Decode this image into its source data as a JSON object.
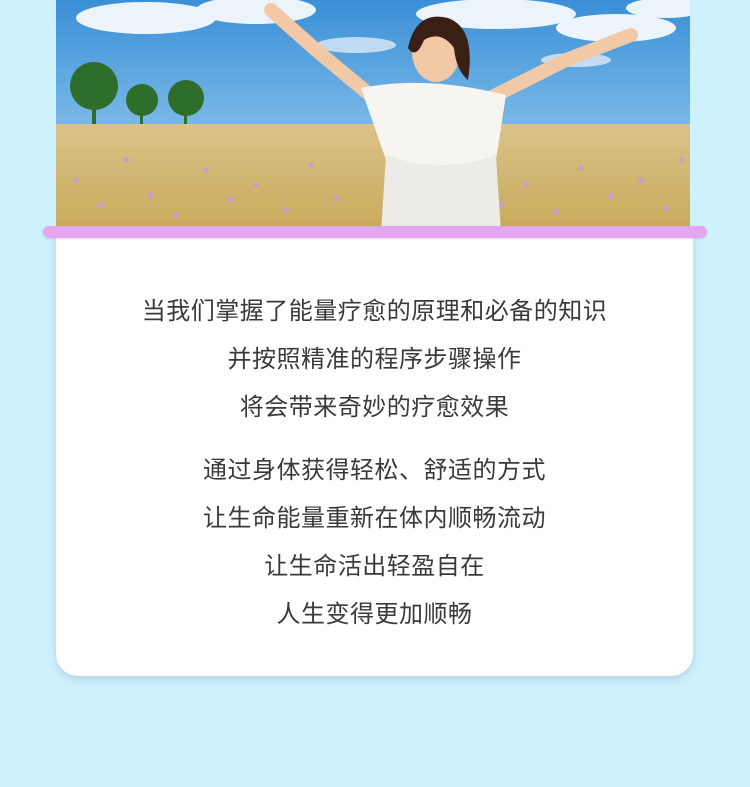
{
  "colors": {
    "background": "#cdf1fd",
    "card": "#ffffff",
    "accent_bar": "#e3a6ef",
    "text": "#3a3a3a"
  },
  "hero": {
    "image": "woman-in-flower-field-photo"
  },
  "content": {
    "paragraph_1": [
      "当我们掌握了能量疗愈的原理和必备的知识",
      "并按照精准的程序步骤操作",
      "将会带来奇妙的疗愈效果"
    ],
    "paragraph_2": [
      "通过身体获得轻松、舒适的方式",
      "让生命能量重新在体内顺畅流动",
      "让生命活出轻盈自在",
      "人生变得更加顺畅"
    ]
  }
}
